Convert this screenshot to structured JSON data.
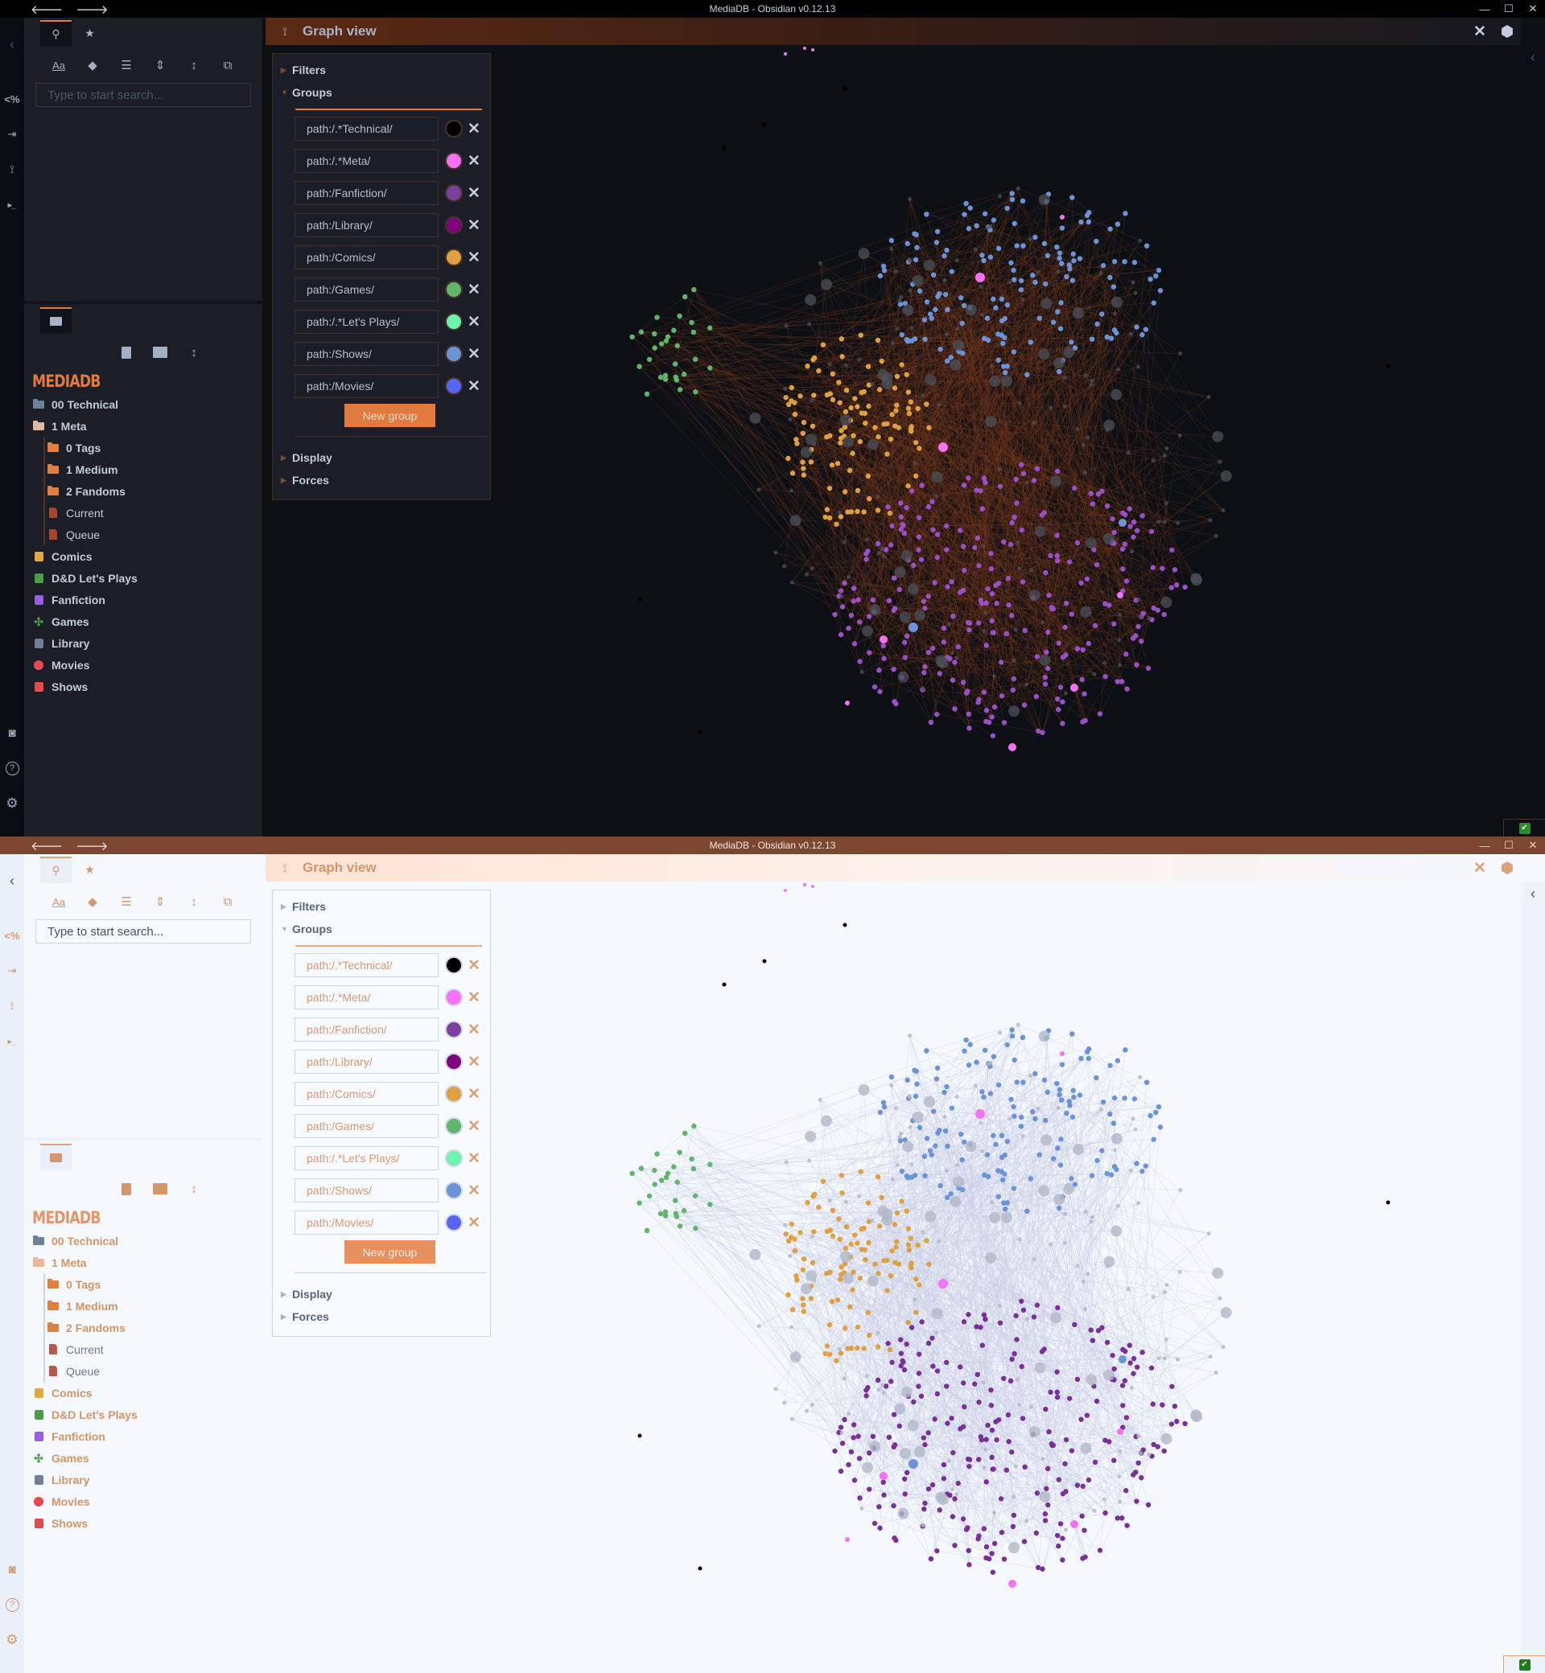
{
  "window": {
    "title": "MediaDB - Obsidian v0.12.13",
    "nav_back": "🡐",
    "nav_forward": "🡒",
    "minimize": "—",
    "maximize": "☐",
    "close": "✕"
  },
  "ribbon": {
    "collapse_left": "‹",
    "items": [
      {
        "name": "templater-icon",
        "glyph": "<%"
      },
      {
        "name": "import-icon",
        "glyph": "⇥"
      },
      {
        "name": "graph-icon",
        "glyph": "⟟"
      },
      {
        "name": "terminal-icon",
        "glyph": "▸_"
      }
    ],
    "bottom": [
      {
        "name": "vault-icon",
        "glyph": "◙"
      },
      {
        "name": "help-icon",
        "glyph": "?"
      },
      {
        "name": "settings-icon",
        "glyph": "⚙"
      }
    ]
  },
  "sidebar": {
    "top_tabs": [
      {
        "name": "search",
        "glyph": "🔍"
      },
      {
        "name": "starred",
        "glyph": "★"
      }
    ],
    "search_tools": [
      {
        "name": "match-case-icon",
        "glyph": "Aa"
      },
      {
        "name": "explain-search-icon",
        "glyph": "◆"
      },
      {
        "name": "collapse-results-icon",
        "glyph": "☰"
      },
      {
        "name": "show-more-context-icon",
        "glyph": "⇕"
      },
      {
        "name": "sort-icon",
        "glyph": "↕"
      },
      {
        "name": "copy-results-icon",
        "glyph": "⧉"
      }
    ],
    "search_placeholder": "Type to start search...",
    "files_tab_glyph": "▬",
    "file_tools": [
      {
        "name": "new-note-icon",
        "glyph": "▤"
      },
      {
        "name": "new-folder-icon",
        "glyph": "▬"
      },
      {
        "name": "sort-order-icon",
        "glyph": "↕"
      }
    ],
    "vault_name": "MEDIADB",
    "tree": [
      {
        "label": "00 Technical",
        "type": "folder",
        "indent": false,
        "icon": "folder-icon",
        "color": "#6f7f95"
      },
      {
        "label": "1 Meta",
        "type": "folder",
        "indent": false,
        "icon": "folder-open-icon",
        "color": "#ddb89e"
      },
      {
        "label": "0 Tags",
        "type": "folder",
        "indent": true,
        "icon": "folder-icon",
        "color": "#e0803f"
      },
      {
        "label": "1 Medium",
        "type": "folder",
        "indent": true,
        "icon": "folder-icon",
        "color": "#e0803f"
      },
      {
        "label": "2 Fandoms",
        "type": "folder",
        "indent": true,
        "icon": "folder-icon",
        "color": "#e0803f"
      },
      {
        "label": "Current",
        "type": "file",
        "indent": true,
        "icon": "file-icon",
        "color": "#a6442e"
      },
      {
        "label": "Queue",
        "type": "file",
        "indent": true,
        "icon": "file-icon",
        "color": "#a6442e"
      },
      {
        "label": "Comics",
        "type": "folder",
        "indent": false,
        "icon": "comic-icon",
        "color": "#e3a93c"
      },
      {
        "label": "D&D Let's Plays",
        "type": "folder",
        "indent": false,
        "icon": "video-icon",
        "color": "#4c9b48"
      },
      {
        "label": "Fanfiction",
        "type": "folder",
        "indent": false,
        "icon": "book-icon",
        "color": "#9b5de5"
      },
      {
        "label": "Games",
        "type": "folder",
        "indent": false,
        "icon": "gamepad-icon",
        "color": "#4c9b48"
      },
      {
        "label": "Library",
        "type": "folder",
        "indent": false,
        "icon": "book-icon",
        "color": "#6f7f95"
      },
      {
        "label": "Movies",
        "type": "folder",
        "indent": false,
        "icon": "film-reel-icon",
        "color": "#e64a4a"
      },
      {
        "label": "Shows",
        "type": "folder",
        "indent": false,
        "icon": "tv-icon",
        "color": "#e64a4a"
      }
    ]
  },
  "graph": {
    "header_icon": "⟟",
    "title": "Graph view",
    "close_glyph": "✕",
    "settings_glyph": "⬢",
    "panel": {
      "filters_label": "Filters",
      "groups_label": "Groups",
      "display_label": "Display",
      "forces_label": "Forces",
      "new_group_label": "New group",
      "remove_glyph": "✕",
      "groups": [
        {
          "query": "path:/.*Technical/",
          "color": "#000000"
        },
        {
          "query": "path:/.*Meta/",
          "color": "#f871f5"
        },
        {
          "query": "path:/Fanfiction/",
          "color": "#7b3fa0"
        },
        {
          "query": "path:/Library/",
          "color": "#800080"
        },
        {
          "query": "path:/Comics/",
          "color": "#e0a040"
        },
        {
          "query": "path:/Games/",
          "color": "#5fb56a"
        },
        {
          "query": "path:/.*Let's Plays/",
          "color": "#6ef5ad"
        },
        {
          "query": "path:/Shows/",
          "color": "#6a93d8"
        },
        {
          "query": "path:/Movies/",
          "color": "#5865f2"
        }
      ]
    }
  },
  "themes": {
    "dark": {
      "edge_color": "#7a3a1c",
      "neutral_node": "#4b5059",
      "accent": "#e07a3f"
    },
    "light": {
      "edge_color": "#c9cde6",
      "neutral_node": "#b2b8c8",
      "accent": "#e7905f"
    }
  },
  "status": {
    "check_glyph": "✔"
  }
}
